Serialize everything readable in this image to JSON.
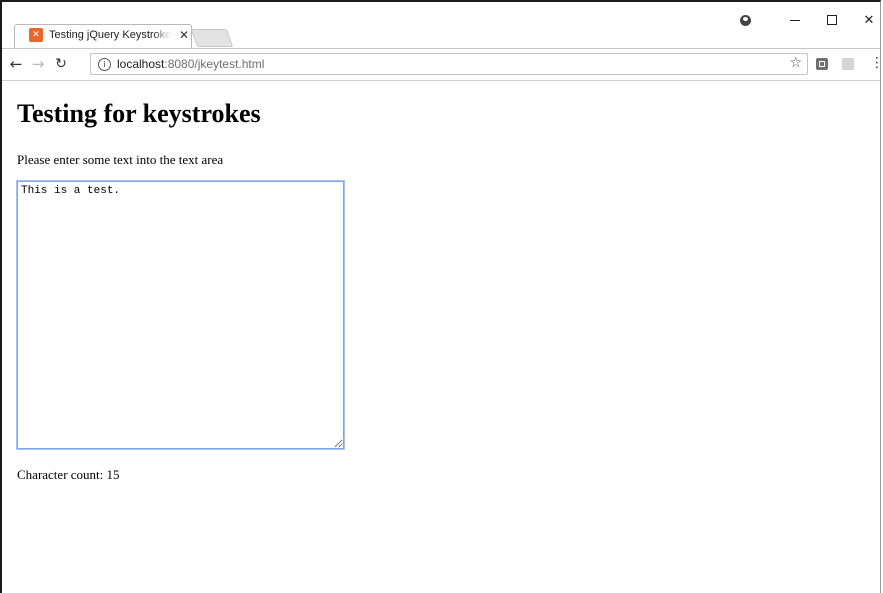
{
  "browser": {
    "tab_title": "Testing jQuery Keystrokes",
    "favicon_glyph": "⊠",
    "favicon_color": "#e8672a",
    "url_host": "localhost",
    "url_rest": ":8080/jkeytest.html"
  },
  "page": {
    "heading": "Testing for keystrokes",
    "prompt": "Please enter some text into the text area",
    "textarea_value": "This is a test.",
    "count_label": "Character count: 15"
  }
}
